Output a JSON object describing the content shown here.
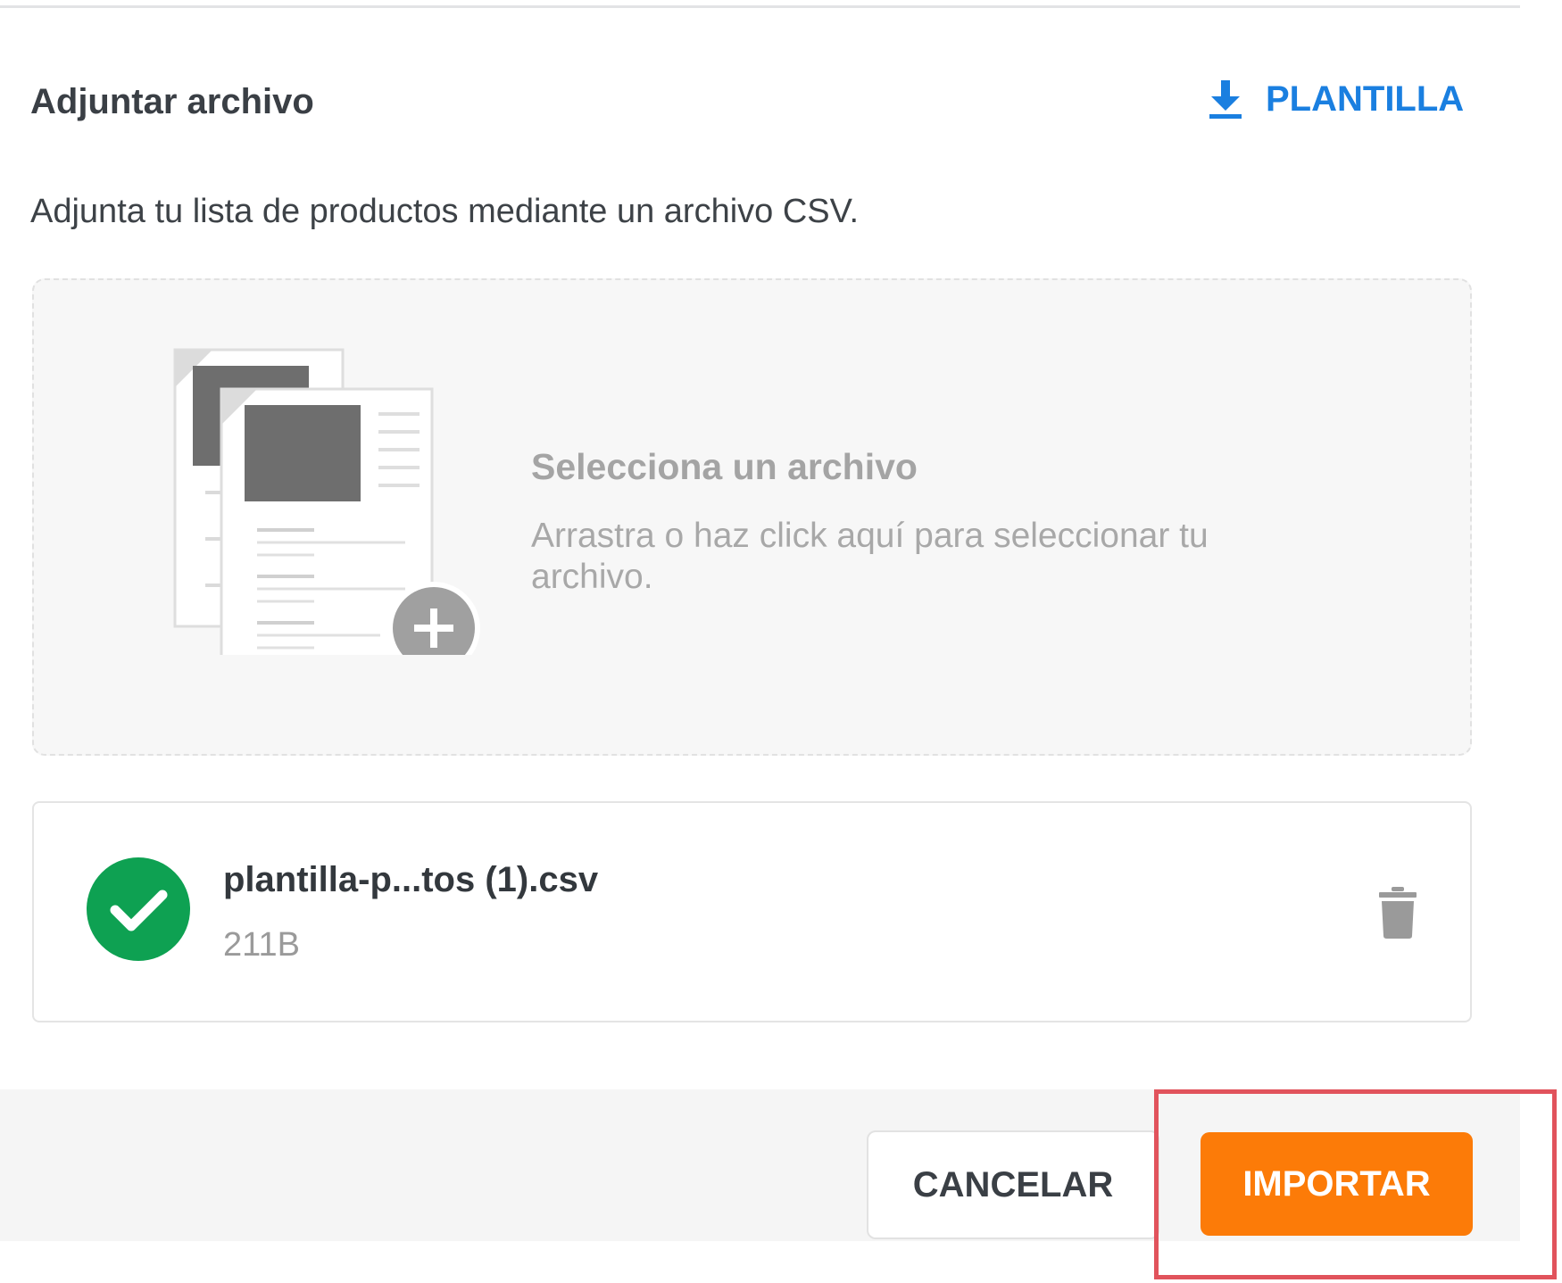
{
  "header": {
    "title": "Adjuntar archivo",
    "template_link_label": "PLANTILLA",
    "template_link_icon": "download-icon"
  },
  "description": "Adjunta tu lista de productos mediante un archivo CSV.",
  "dropzone": {
    "title": "Selecciona un archivo",
    "hint": "Arrastra o haz click aquí para seleccionar tu archivo.",
    "illustration_icon": "documents-add-icon"
  },
  "file": {
    "name": "plantilla-p...tos (1).csv",
    "size": "211B",
    "status_icon": "check-circle-icon",
    "delete_icon": "trash-icon"
  },
  "footer": {
    "cancel_label": "CANCELAR",
    "import_label": "IMPORTAR"
  },
  "colors": {
    "accent_blue": "#1a7fe0",
    "primary_orange": "#fc7b08",
    "success_green": "#0ea152",
    "highlight_red": "#e1535c"
  }
}
